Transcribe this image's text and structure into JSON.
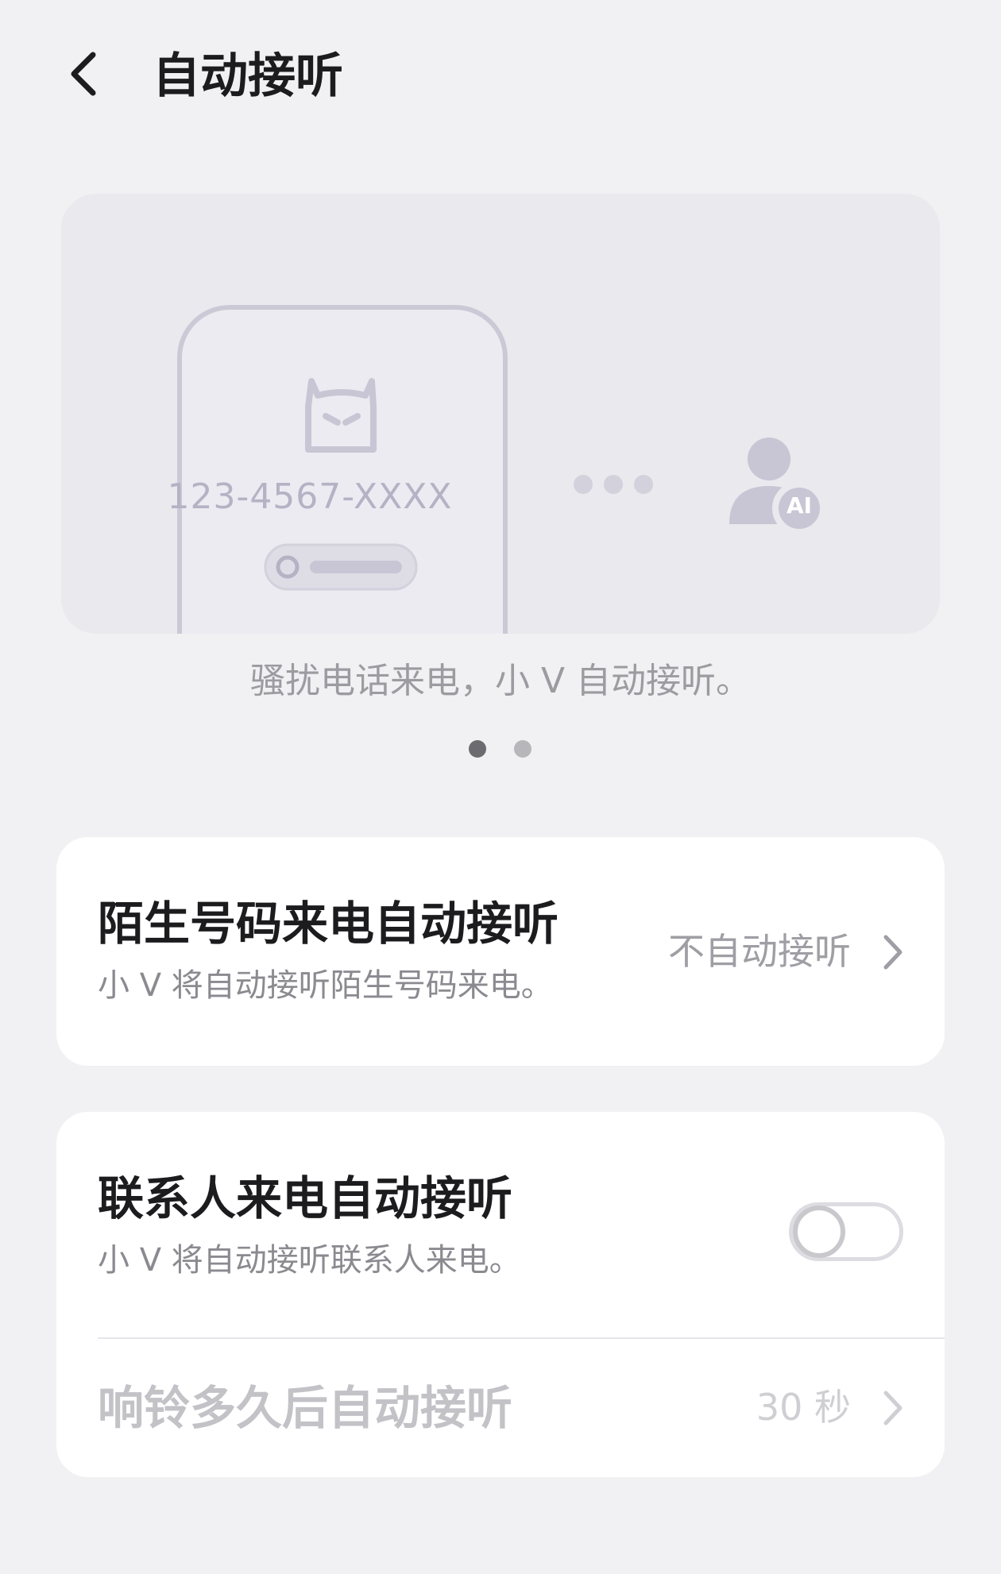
{
  "header": {
    "title": "自动接听",
    "back_icon": "chevron-left-icon"
  },
  "illustration": {
    "phone_number": "123-4567-XXXX",
    "ai_badge": "AI",
    "caption": "骚扰电话来电，小 V 自动接听。",
    "page_dots": {
      "count": 2,
      "active_index": 0
    }
  },
  "stranger_card": {
    "title": "陌生号码来电自动接听",
    "subtitle": "小 V 将自动接听陌生号码来电。",
    "value": "不自动接听"
  },
  "contacts_card": {
    "title": "联系人来电自动接听",
    "subtitle": "小 V 将自动接听联系人来电。",
    "toggle_on": false,
    "delay_title": "响铃多久后自动接听",
    "delay_value": "30 秒"
  },
  "colors": {
    "background": "#f1f1f3",
    "card": "#ffffff",
    "illustration_bg": "#e9e9ee",
    "illustration_fg": "#c8c6d4",
    "disabled_text": "#c2c2c7"
  }
}
